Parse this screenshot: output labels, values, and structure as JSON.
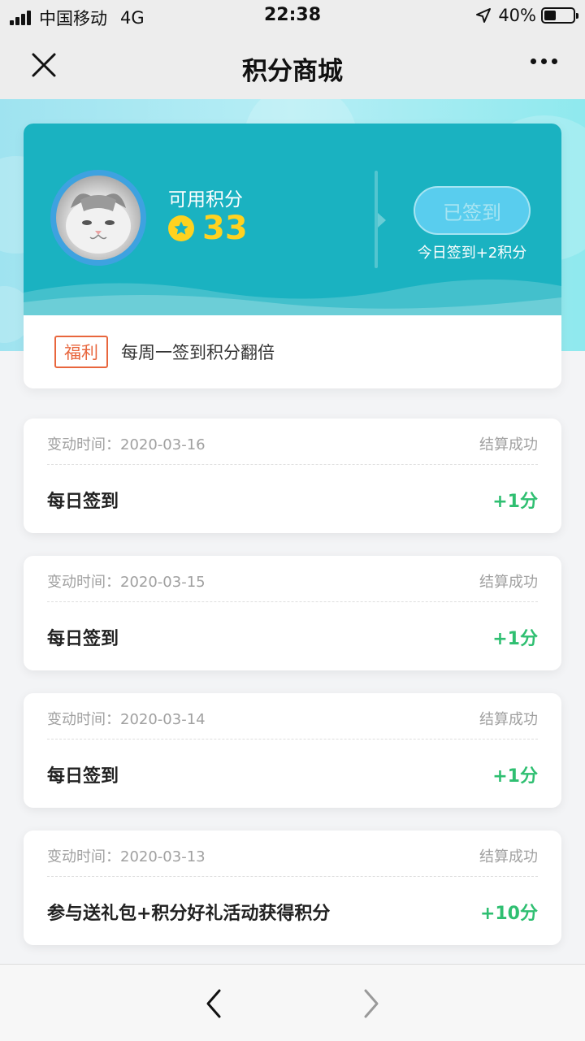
{
  "status_bar": {
    "carrier": "中国移动",
    "network": "4G",
    "time": "22:38",
    "battery": "40%"
  },
  "nav": {
    "title": "积分商城",
    "close_icon": "close-icon",
    "more_icon": "more-icon"
  },
  "points_card": {
    "label": "可用积分",
    "value": "33",
    "coin_icon": "star-coin-icon",
    "signed_button": "已签到",
    "sign_hint": "今日签到+2积分",
    "welfare_tag": "福利",
    "welfare_text": "每周一签到积分翻倍"
  },
  "records": [
    {
      "time_label": "变动时间：",
      "date": "2020-03-16",
      "status": "结算成功",
      "title": "每日签到",
      "points": "+1分"
    },
    {
      "time_label": "变动时间：",
      "date": "2020-03-15",
      "status": "结算成功",
      "title": "每日签到",
      "points": "+1分"
    },
    {
      "time_label": "变动时间：",
      "date": "2020-03-14",
      "status": "结算成功",
      "title": "每日签到",
      "points": "+1分"
    },
    {
      "time_label": "变动时间：",
      "date": "2020-03-13",
      "status": "结算成功",
      "title": "参与送礼包+积分好礼活动获得积分",
      "points": "+10分"
    }
  ],
  "toolbar": {
    "back_icon": "chevron-left-icon",
    "forward_icon": "chevron-right-icon"
  },
  "colors": {
    "card_teal": "#1ab2c1",
    "coin_yellow": "#ffd21f",
    "points_green": "#2fbf71",
    "welfare_orange": "#e8663d"
  }
}
